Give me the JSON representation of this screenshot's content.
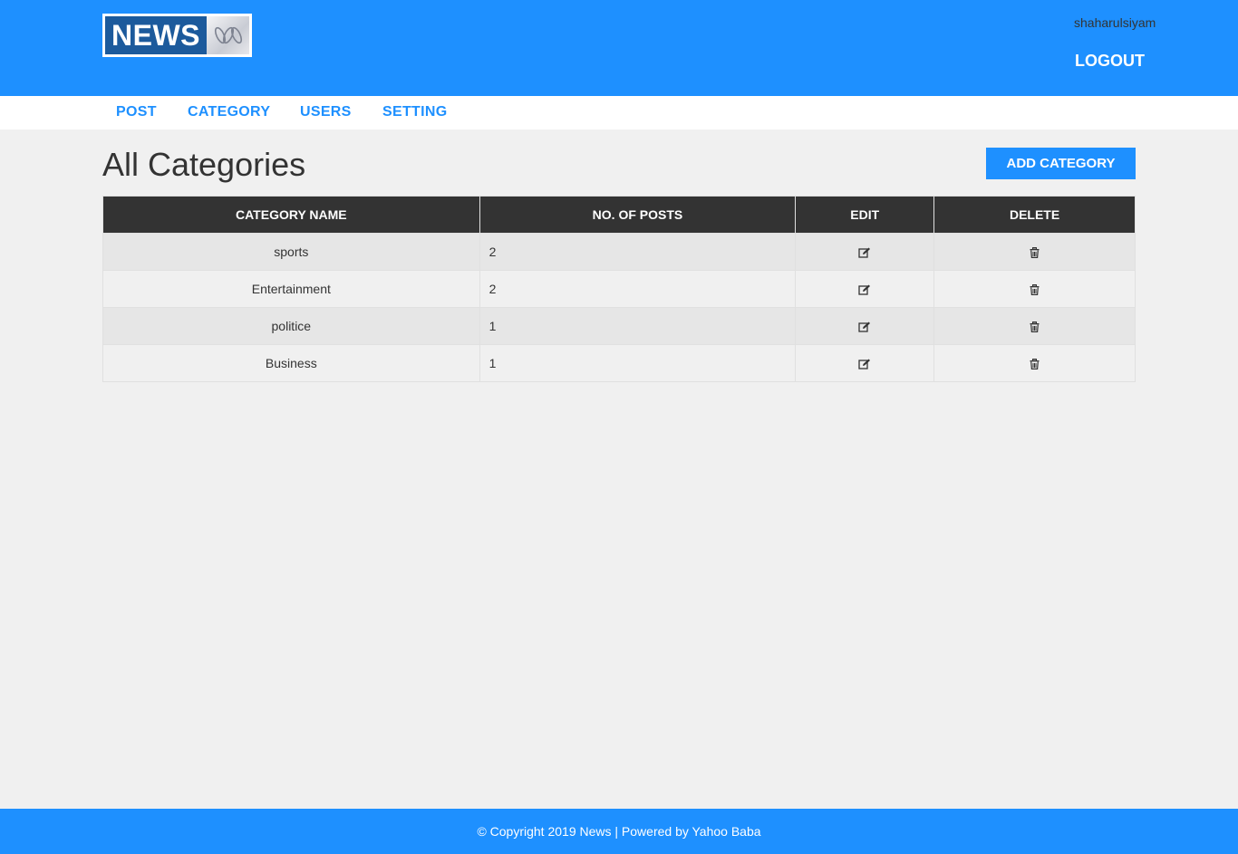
{
  "header": {
    "logo_text": "NEWS",
    "username": "shaharulsiyam",
    "logout_label": "LOGOUT"
  },
  "nav": [
    {
      "label": "POST"
    },
    {
      "label": "CATEGORY"
    },
    {
      "label": "USERS"
    },
    {
      "label": "SETTING"
    }
  ],
  "main": {
    "title": "All Categories",
    "add_button_label": "ADD CATEGORY",
    "table": {
      "columns": [
        "CATEGORY NAME",
        "NO. OF POSTS",
        "EDIT",
        "DELETE"
      ],
      "rows": [
        {
          "name": "sports",
          "posts": "2",
          "edit_icon": "edit-icon",
          "delete_icon": "trash-icon"
        },
        {
          "name": "Entertainment",
          "posts": "2",
          "edit_icon": "edit-icon",
          "delete_icon": "trash-icon"
        },
        {
          "name": "politice",
          "posts": "1",
          "edit_icon": "edit-icon",
          "delete_icon": "trash-icon"
        },
        {
          "name": "Business",
          "posts": "1",
          "edit_icon": "edit-icon",
          "delete_icon": "trash-icon"
        }
      ]
    }
  },
  "footer": {
    "text": "© Copyright 2019 News | Powered by Yahoo Baba"
  },
  "colors": {
    "brand_blue": "#1e90ff",
    "table_header": "#333333",
    "logo_blue": "#1c5a9c"
  }
}
